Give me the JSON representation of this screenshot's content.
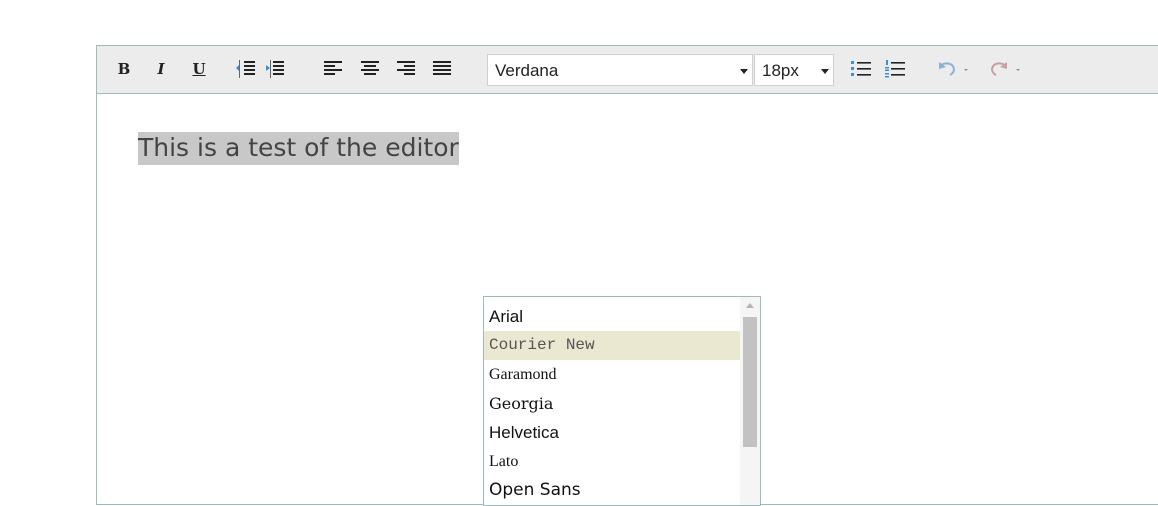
{
  "toolbar": {
    "bold_label": "B",
    "italic_label": "I",
    "underline_label": "U",
    "font_family": "Verdana",
    "font_size": "18px"
  },
  "icons": {
    "indent": "indent-icon",
    "outdent": "outdent-icon",
    "align_left": "align-left-icon",
    "align_center": "align-center-icon",
    "align_right": "align-right-icon",
    "align_justify": "align-justify-icon",
    "bullet_list": "bullet-list-icon",
    "numbered_list": "numbered-list-icon",
    "undo": "undo-icon",
    "redo": "redo-icon"
  },
  "editor": {
    "content_text": "This is a test of the editor"
  },
  "font_dropdown": {
    "options": [
      "Arial",
      "Courier New",
      "Garamond",
      "Georgia",
      "Helvetica",
      "Lato",
      "Open Sans"
    ],
    "highlighted": "Courier New"
  },
  "colors": {
    "border": "#9cbcbc",
    "toolbar_bg": "#ececec",
    "selection_bg": "#c8c8c8",
    "hover_bg": "#ebe8d2",
    "undo_redo": "#8fb0d8"
  }
}
